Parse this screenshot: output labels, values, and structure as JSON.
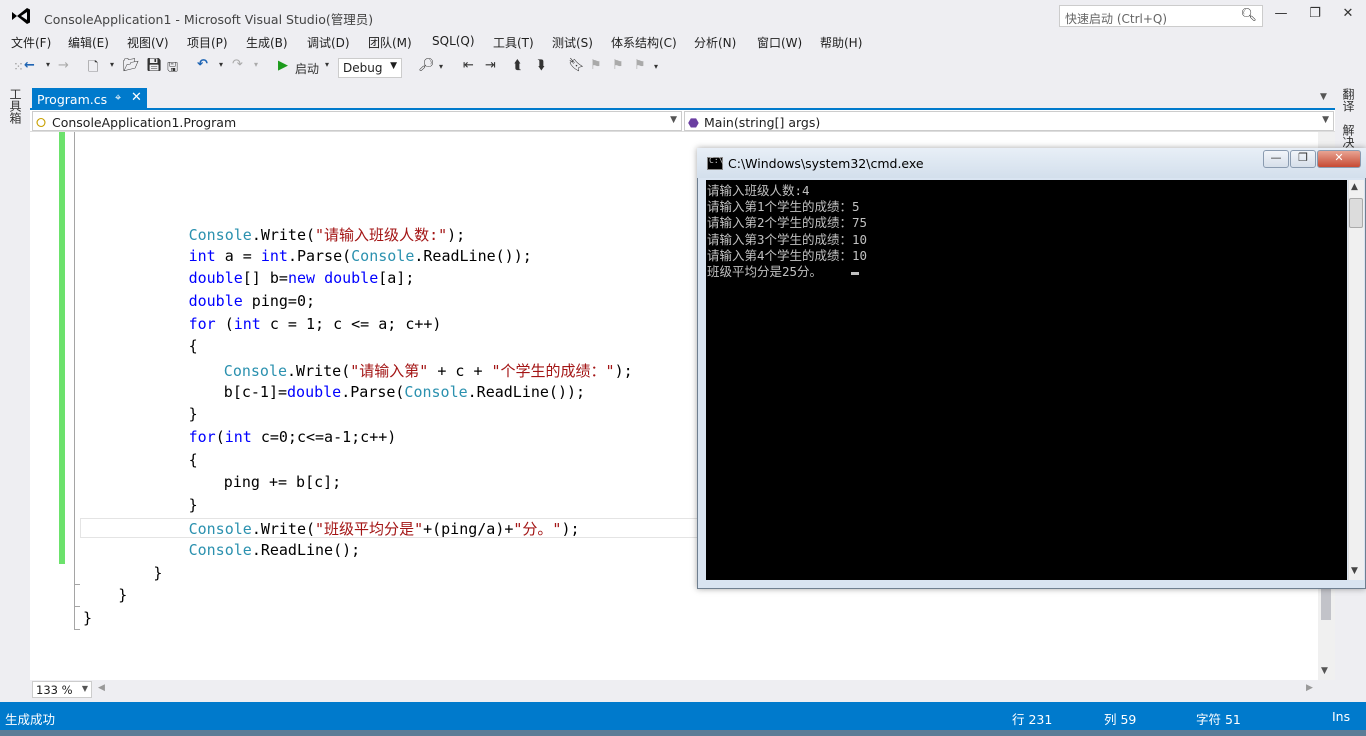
{
  "window": {
    "title": "ConsoleApplication1 - Microsoft Visual Studio(管理员)",
    "quick_launch_placeholder": "快速启动 (Ctrl+Q)"
  },
  "menu": [
    "文件(F)",
    "编辑(E)",
    "视图(V)",
    "项目(P)",
    "生成(B)",
    "调试(D)",
    "团队(M)",
    "SQL(Q)",
    "工具(T)",
    "测试(S)",
    "体系结构(C)",
    "分析(N)",
    "窗口(W)",
    "帮助(H)"
  ],
  "toolbar": {
    "start_label": "启动",
    "config": "Debug"
  },
  "side_tabs": {
    "left": "工具箱",
    "right_1": "翻译",
    "right_2": "解决"
  },
  "document_tab": {
    "name": "Program.cs"
  },
  "nav": {
    "type": "ConsoleApplication1.Program",
    "member": "Main(string[] args)"
  },
  "code_lines": [
    {
      "indent": 3,
      "parts": [
        [
          "ty",
          "Console"
        ],
        [
          "n",
          "."
        ],
        [
          "n",
          "Write"
        ],
        [
          "n",
          "("
        ],
        [
          "st",
          "\"请输入班级人数:\""
        ],
        [
          "n",
          ");"
        ]
      ]
    },
    {
      "indent": 3,
      "parts": [
        [
          "kw",
          "int"
        ],
        [
          "n",
          " a = "
        ],
        [
          "kw",
          "int"
        ],
        [
          "n",
          ".Parse("
        ],
        [
          "ty",
          "Console"
        ],
        [
          "n",
          ".ReadLine());"
        ]
      ]
    },
    {
      "indent": 3,
      "parts": [
        [
          "kw",
          "double"
        ],
        [
          "n",
          "[] b="
        ],
        [
          "kw",
          "new"
        ],
        [
          "n",
          " "
        ],
        [
          "kw",
          "double"
        ],
        [
          "n",
          "[a];"
        ]
      ]
    },
    {
      "indent": 3,
      "parts": [
        [
          "kw",
          "double"
        ],
        [
          "n",
          " ping=0;"
        ]
      ]
    },
    {
      "indent": 3,
      "parts": [
        [
          "kw",
          "for"
        ],
        [
          "n",
          " ("
        ],
        [
          "kw",
          "int"
        ],
        [
          "n",
          " c = 1; c <= a; c++)"
        ]
      ]
    },
    {
      "indent": 3,
      "parts": [
        [
          "n",
          "{"
        ]
      ]
    },
    {
      "indent": 4,
      "parts": [
        [
          "ty",
          "Console"
        ],
        [
          "n",
          ".Write("
        ],
        [
          "st",
          "\"请输入第\""
        ],
        [
          "n",
          " + c + "
        ],
        [
          "st",
          "\"个学生的成绩：\""
        ],
        [
          "n",
          ");"
        ]
      ]
    },
    {
      "indent": 4,
      "parts": [
        [
          "n",
          "b[c-1]="
        ],
        [
          "kw",
          "double"
        ],
        [
          "n",
          ".Parse("
        ],
        [
          "ty",
          "Console"
        ],
        [
          "n",
          ".ReadLine());"
        ]
      ]
    },
    {
      "indent": 3,
      "parts": [
        [
          "n",
          "}"
        ]
      ]
    },
    {
      "indent": 3,
      "parts": [
        [
          "kw",
          "for"
        ],
        [
          "n",
          "("
        ],
        [
          "kw",
          "int"
        ],
        [
          "n",
          " c=0;c<=a-1;c++)"
        ]
      ]
    },
    {
      "indent": 3,
      "parts": [
        [
          "n",
          "{"
        ]
      ]
    },
    {
      "indent": 4,
      "parts": [
        [
          "n",
          "ping += b[c];"
        ]
      ]
    },
    {
      "indent": 3,
      "parts": [
        [
          "n",
          "}"
        ]
      ]
    },
    {
      "indent": 3,
      "parts": [
        [
          "ty",
          "Console"
        ],
        [
          "n",
          ".Write("
        ],
        [
          "st",
          "\"班级平均分是\""
        ],
        [
          "n",
          "+(ping/a)+"
        ],
        [
          "st",
          "\"分。\""
        ],
        [
          "n",
          ");"
        ]
      ]
    },
    {
      "indent": 3,
      "parts": [
        [
          "ty",
          "Console"
        ],
        [
          "n",
          ".ReadLine();"
        ]
      ]
    },
    {
      "indent": 2,
      "parts": [
        [
          "n",
          "}"
        ]
      ]
    },
    {
      "indent": 1,
      "parts": [
        [
          "n",
          "}"
        ]
      ]
    },
    {
      "indent": 0,
      "parts": [
        [
          "n",
          "}"
        ]
      ]
    }
  ],
  "editor": {
    "zoom": "133 %"
  },
  "status": {
    "message": "生成成功",
    "line": "行 231",
    "col": "列 59",
    "ch": "字符 51",
    "mode": "Ins"
  },
  "cmd": {
    "title": "C:\\Windows\\system32\\cmd.exe",
    "icon_text": "C:\\",
    "lines": [
      "请输入班级人数:4",
      "请输入第1个学生的成绩：5",
      "请输入第2个学生的成绩：75",
      "请输入第3个学生的成绩：10",
      "请输入第4个学生的成绩：10",
      "班级平均分是25分。"
    ]
  },
  "colors": {
    "accent": "#007acc",
    "keyword": "#0000ff",
    "type": "#2b91af",
    "string": "#a31515",
    "change_marker": "#6ce26c"
  }
}
